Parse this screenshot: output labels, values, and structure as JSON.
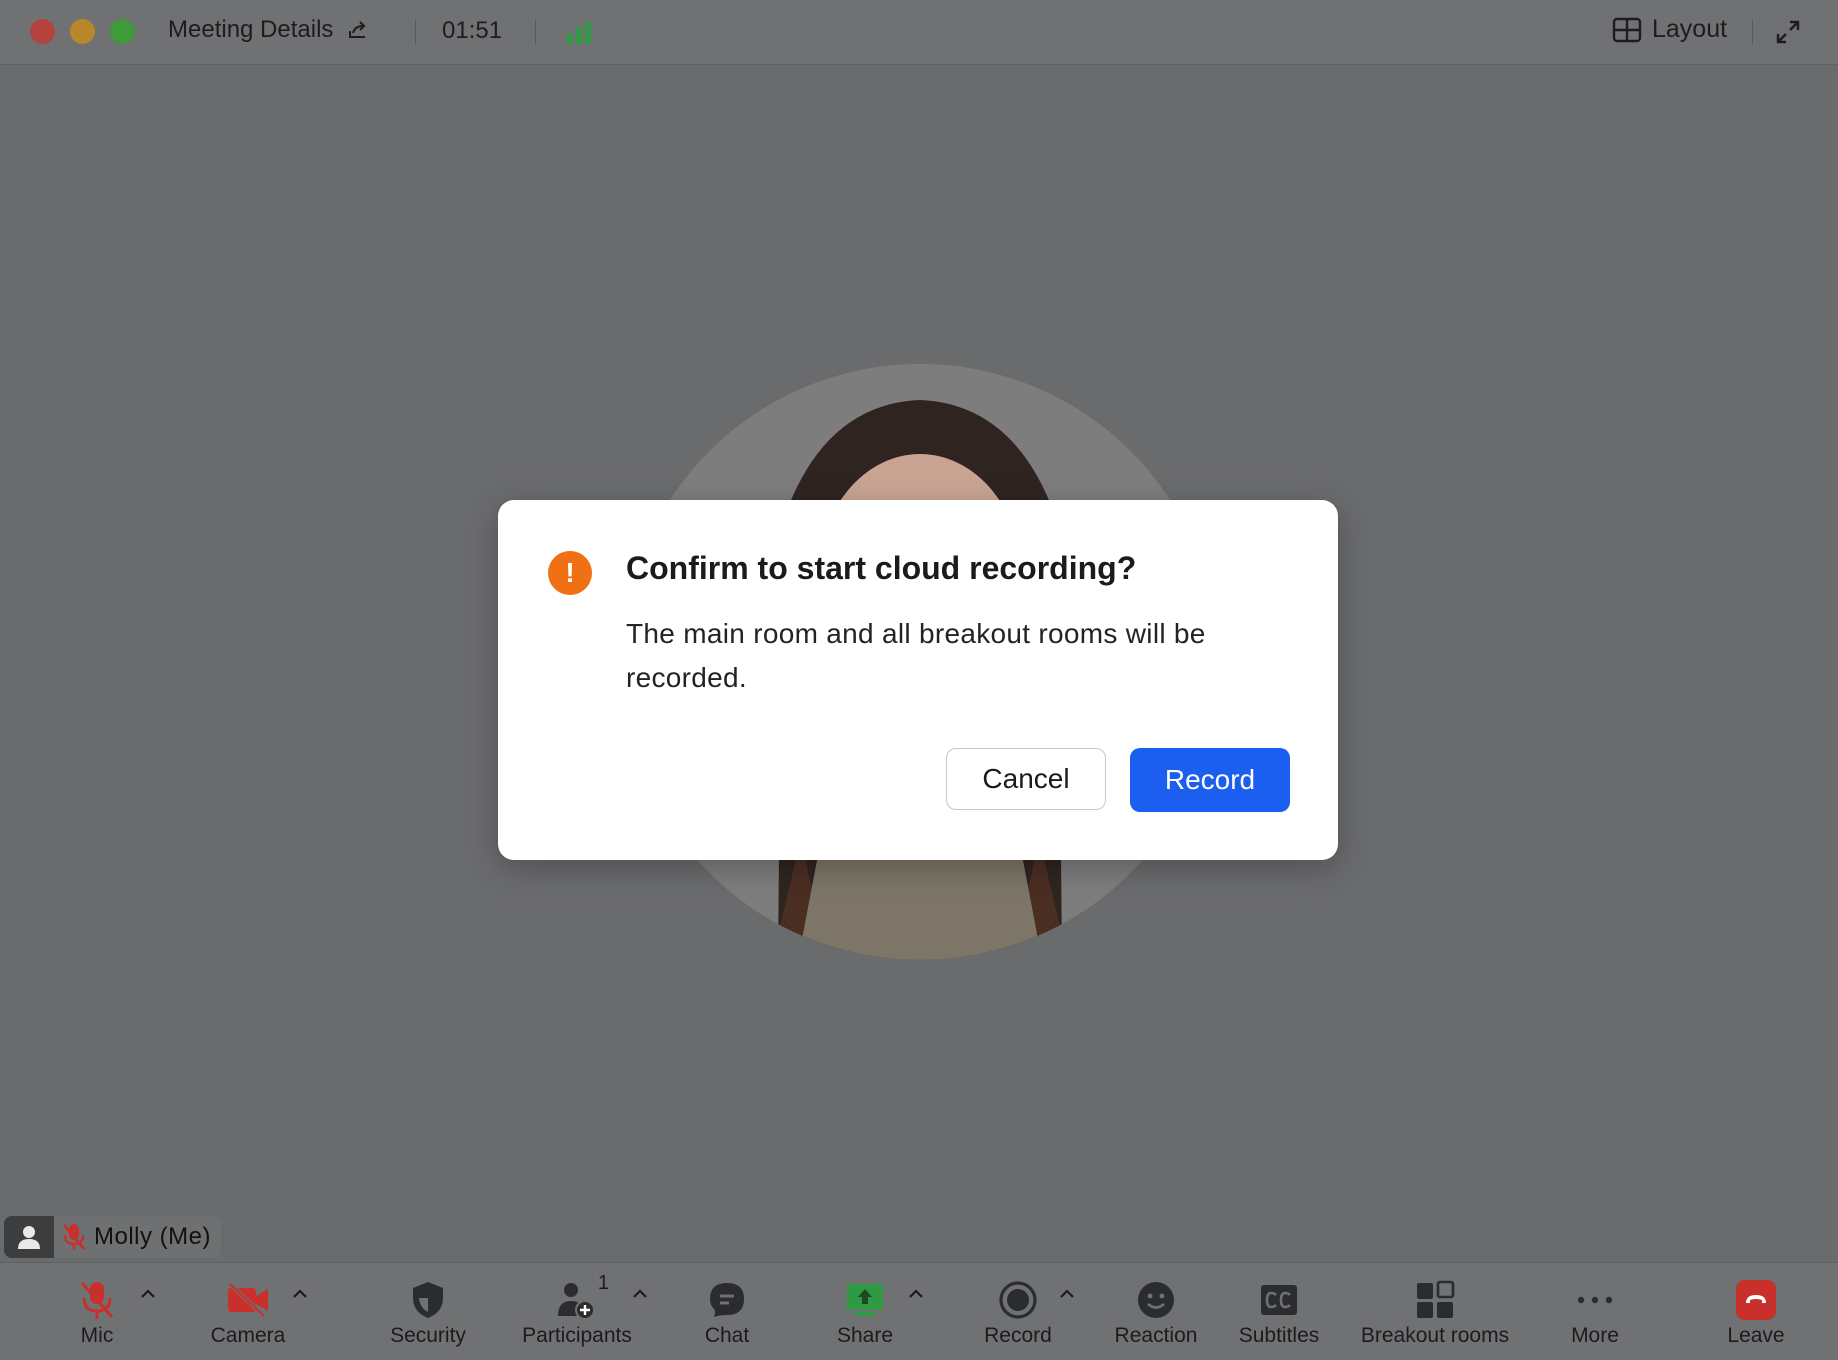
{
  "titlebar": {
    "meeting_details": "Meeting Details",
    "timer": "01:51",
    "layout_label": "Layout"
  },
  "dialog": {
    "title": "Confirm to start cloud recording?",
    "body": "The main room and all breakout rooms will be recorded.",
    "cancel": "Cancel",
    "record": "Record"
  },
  "nametag": {
    "name": "Molly (Me)"
  },
  "toolbar": {
    "mic": "Mic",
    "camera": "Camera",
    "security": "Security",
    "participants": "Participants",
    "participants_count": "1",
    "chat": "Chat",
    "share": "Share",
    "record": "Record",
    "reaction": "Reaction",
    "subtitles": "Subtitles",
    "breakout_rooms": "Breakout rooms",
    "more": "More",
    "leave": "Leave"
  },
  "colors": {
    "primary": "#1b5ef0",
    "warning": "#f27014",
    "muted_red": "#c9302c",
    "share_green": "#2f9a43",
    "signal_green": "#2f9a43"
  }
}
